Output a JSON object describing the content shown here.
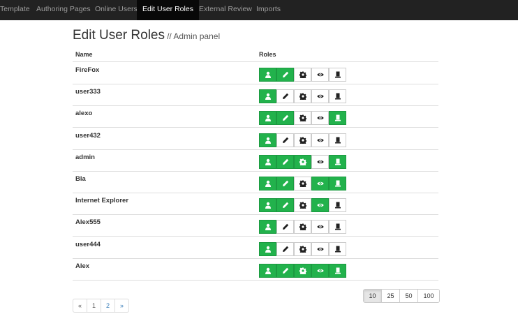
{
  "nav": {
    "items": [
      "Template",
      "Authoring Pages",
      "Online Users",
      "Edit User Roles",
      "External Review",
      "Imports"
    ],
    "active_index": 3
  },
  "page": {
    "title": "Edit User Roles",
    "subtitle": "// Admin panel"
  },
  "table": {
    "columns": [
      "Name",
      "Roles"
    ],
    "role_icons": [
      "user-icon",
      "pencil-icon",
      "gear-icon",
      "eye-icon",
      "tophat-icon"
    ],
    "active_color": "#22b24c",
    "rows": [
      {
        "name": "FireFox",
        "roles": [
          true,
          true,
          false,
          false,
          false
        ]
      },
      {
        "name": "user333",
        "roles": [
          true,
          false,
          false,
          false,
          false
        ]
      },
      {
        "name": "alexo",
        "roles": [
          true,
          true,
          false,
          false,
          true
        ]
      },
      {
        "name": "user432",
        "roles": [
          true,
          false,
          false,
          false,
          false
        ]
      },
      {
        "name": "admin",
        "roles": [
          true,
          true,
          true,
          false,
          true
        ]
      },
      {
        "name": "Bla",
        "roles": [
          true,
          true,
          false,
          true,
          true
        ]
      },
      {
        "name": "Internet Explorer",
        "roles": [
          true,
          true,
          false,
          true,
          false
        ]
      },
      {
        "name": "Alex555",
        "roles": [
          true,
          false,
          false,
          false,
          false
        ]
      },
      {
        "name": "user444",
        "roles": [
          true,
          false,
          false,
          false,
          false
        ]
      },
      {
        "name": "Alex",
        "roles": [
          true,
          true,
          true,
          true,
          true
        ]
      }
    ]
  },
  "pagination": {
    "prev": "«",
    "pages": [
      "1",
      "2"
    ],
    "next": "»"
  },
  "page_size": {
    "options": [
      "10",
      "25",
      "50",
      "100"
    ],
    "selected": "10"
  }
}
